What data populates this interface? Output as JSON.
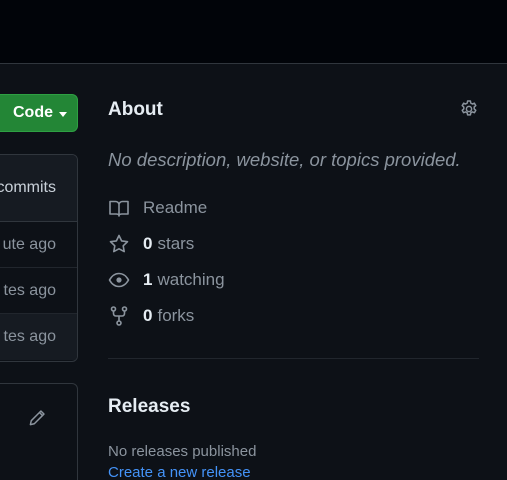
{
  "repo": {
    "code_button_label": "Code",
    "files_header": "commits",
    "file_rows": [
      "ute ago",
      "tes ago",
      "tes ago"
    ]
  },
  "about": {
    "title": "About",
    "description": "No description, website, or topics provided.",
    "readme_label": "Readme",
    "stars_count": "0",
    "stars_label": "stars",
    "watching_count": "1",
    "watching_label": "watching",
    "forks_count": "0",
    "forks_label": "forks"
  },
  "releases": {
    "title": "Releases",
    "empty_text": "No releases published",
    "create_link": "Create a new release"
  },
  "icons": [
    "gear-icon",
    "book-icon",
    "star-icon",
    "eye-icon",
    "fork-icon",
    "pencil-icon",
    "caret-down-icon"
  ],
  "colors": {
    "background": "#0d1117",
    "topbar": "#010409",
    "code_button": "#238636",
    "muted_text": "#8b949e",
    "link": "#4493f8",
    "border": "#30363d"
  }
}
